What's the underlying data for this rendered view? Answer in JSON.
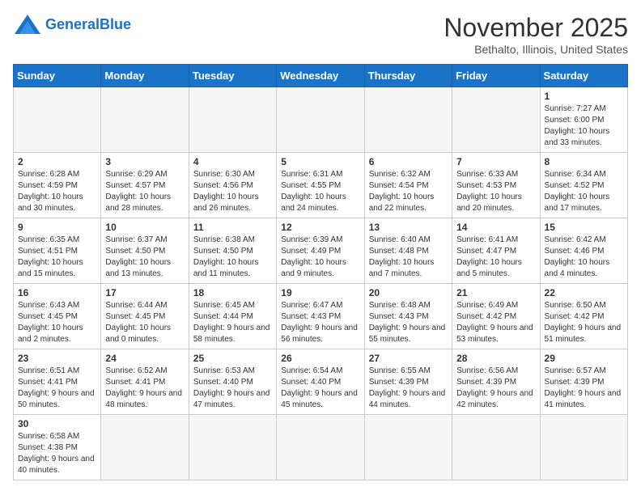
{
  "header": {
    "logo_general": "General",
    "logo_blue": "Blue",
    "month": "November 2025",
    "location": "Bethalto, Illinois, United States"
  },
  "days_of_week": [
    "Sunday",
    "Monday",
    "Tuesday",
    "Wednesday",
    "Thursday",
    "Friday",
    "Saturday"
  ],
  "weeks": [
    [
      {
        "day": "",
        "info": ""
      },
      {
        "day": "",
        "info": ""
      },
      {
        "day": "",
        "info": ""
      },
      {
        "day": "",
        "info": ""
      },
      {
        "day": "",
        "info": ""
      },
      {
        "day": "",
        "info": ""
      },
      {
        "day": "1",
        "info": "Sunrise: 7:27 AM\nSunset: 6:00 PM\nDaylight: 10 hours and 33 minutes."
      }
    ],
    [
      {
        "day": "2",
        "info": "Sunrise: 6:28 AM\nSunset: 4:59 PM\nDaylight: 10 hours and 30 minutes."
      },
      {
        "day": "3",
        "info": "Sunrise: 6:29 AM\nSunset: 4:57 PM\nDaylight: 10 hours and 28 minutes."
      },
      {
        "day": "4",
        "info": "Sunrise: 6:30 AM\nSunset: 4:56 PM\nDaylight: 10 hours and 26 minutes."
      },
      {
        "day": "5",
        "info": "Sunrise: 6:31 AM\nSunset: 4:55 PM\nDaylight: 10 hours and 24 minutes."
      },
      {
        "day": "6",
        "info": "Sunrise: 6:32 AM\nSunset: 4:54 PM\nDaylight: 10 hours and 22 minutes."
      },
      {
        "day": "7",
        "info": "Sunrise: 6:33 AM\nSunset: 4:53 PM\nDaylight: 10 hours and 20 minutes."
      },
      {
        "day": "8",
        "info": "Sunrise: 6:34 AM\nSunset: 4:52 PM\nDaylight: 10 hours and 17 minutes."
      }
    ],
    [
      {
        "day": "9",
        "info": "Sunrise: 6:35 AM\nSunset: 4:51 PM\nDaylight: 10 hours and 15 minutes."
      },
      {
        "day": "10",
        "info": "Sunrise: 6:37 AM\nSunset: 4:50 PM\nDaylight: 10 hours and 13 minutes."
      },
      {
        "day": "11",
        "info": "Sunrise: 6:38 AM\nSunset: 4:50 PM\nDaylight: 10 hours and 11 minutes."
      },
      {
        "day": "12",
        "info": "Sunrise: 6:39 AM\nSunset: 4:49 PM\nDaylight: 10 hours and 9 minutes."
      },
      {
        "day": "13",
        "info": "Sunrise: 6:40 AM\nSunset: 4:48 PM\nDaylight: 10 hours and 7 minutes."
      },
      {
        "day": "14",
        "info": "Sunrise: 6:41 AM\nSunset: 4:47 PM\nDaylight: 10 hours and 5 minutes."
      },
      {
        "day": "15",
        "info": "Sunrise: 6:42 AM\nSunset: 4:46 PM\nDaylight: 10 hours and 4 minutes."
      }
    ],
    [
      {
        "day": "16",
        "info": "Sunrise: 6:43 AM\nSunset: 4:45 PM\nDaylight: 10 hours and 2 minutes."
      },
      {
        "day": "17",
        "info": "Sunrise: 6:44 AM\nSunset: 4:45 PM\nDaylight: 10 hours and 0 minutes."
      },
      {
        "day": "18",
        "info": "Sunrise: 6:45 AM\nSunset: 4:44 PM\nDaylight: 9 hours and 58 minutes."
      },
      {
        "day": "19",
        "info": "Sunrise: 6:47 AM\nSunset: 4:43 PM\nDaylight: 9 hours and 56 minutes."
      },
      {
        "day": "20",
        "info": "Sunrise: 6:48 AM\nSunset: 4:43 PM\nDaylight: 9 hours and 55 minutes."
      },
      {
        "day": "21",
        "info": "Sunrise: 6:49 AM\nSunset: 4:42 PM\nDaylight: 9 hours and 53 minutes."
      },
      {
        "day": "22",
        "info": "Sunrise: 6:50 AM\nSunset: 4:42 PM\nDaylight: 9 hours and 51 minutes."
      }
    ],
    [
      {
        "day": "23",
        "info": "Sunrise: 6:51 AM\nSunset: 4:41 PM\nDaylight: 9 hours and 50 minutes."
      },
      {
        "day": "24",
        "info": "Sunrise: 6:52 AM\nSunset: 4:41 PM\nDaylight: 9 hours and 48 minutes."
      },
      {
        "day": "25",
        "info": "Sunrise: 6:53 AM\nSunset: 4:40 PM\nDaylight: 9 hours and 47 minutes."
      },
      {
        "day": "26",
        "info": "Sunrise: 6:54 AM\nSunset: 4:40 PM\nDaylight: 9 hours and 45 minutes."
      },
      {
        "day": "27",
        "info": "Sunrise: 6:55 AM\nSunset: 4:39 PM\nDaylight: 9 hours and 44 minutes."
      },
      {
        "day": "28",
        "info": "Sunrise: 6:56 AM\nSunset: 4:39 PM\nDaylight: 9 hours and 42 minutes."
      },
      {
        "day": "29",
        "info": "Sunrise: 6:57 AM\nSunset: 4:39 PM\nDaylight: 9 hours and 41 minutes."
      }
    ],
    [
      {
        "day": "30",
        "info": "Sunrise: 6:58 AM\nSunset: 4:38 PM\nDaylight: 9 hours and 40 minutes."
      },
      {
        "day": "",
        "info": ""
      },
      {
        "day": "",
        "info": ""
      },
      {
        "day": "",
        "info": ""
      },
      {
        "day": "",
        "info": ""
      },
      {
        "day": "",
        "info": ""
      },
      {
        "day": "",
        "info": ""
      }
    ]
  ]
}
